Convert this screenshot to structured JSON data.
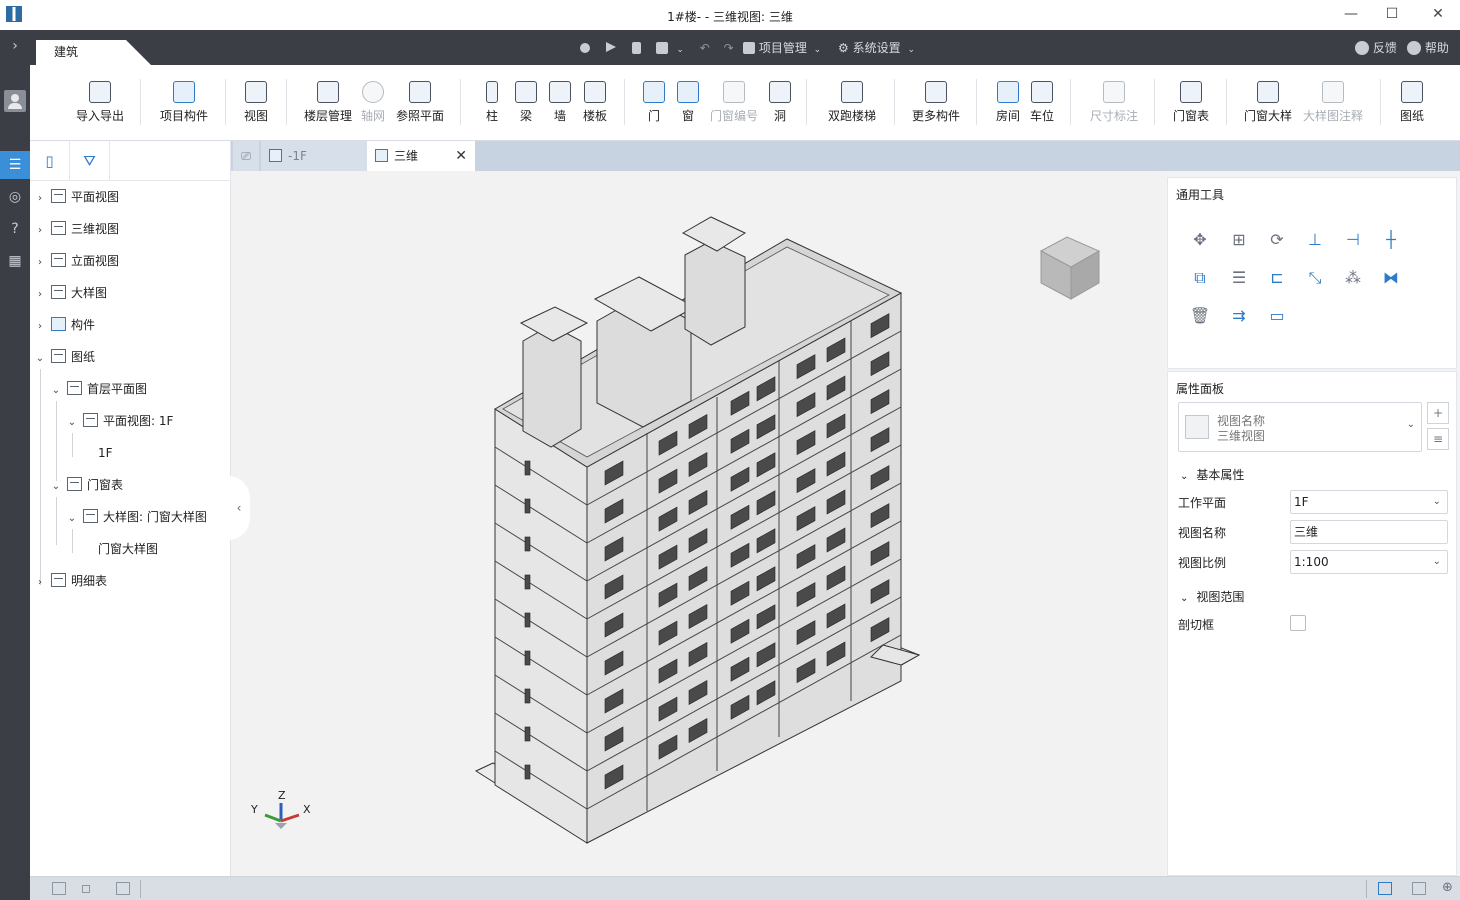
{
  "window": {
    "title": "1#楼- - 三维视图: 三维",
    "controls": [
      "—",
      "☐",
      "✕"
    ]
  },
  "rail": {
    "items": [
      "expand-icon",
      "user-icon",
      "list-icon",
      "compass-icon",
      "help-icon",
      "grid-icon"
    ]
  },
  "header": {
    "tab_label": "建筑",
    "project_menu": "项目管理",
    "settings_menu": "系统设置",
    "feedback": "反馈",
    "help": "帮助"
  },
  "ribbon": {
    "buttons": [
      {
        "label": "导入导出",
        "icon": "cad-icon",
        "enabled": true
      },
      {
        "label": "项目构件",
        "icon": "component-icon",
        "enabled": true
      },
      {
        "label": "视图",
        "icon": "view-icon",
        "enabled": true
      },
      {
        "label": "楼层管理",
        "icon": "floor-icon",
        "enabled": true
      },
      {
        "label": "轴网",
        "icon": "grid-axis-icon",
        "enabled": false
      },
      {
        "label": "参照平面",
        "icon": "ref-plane-icon",
        "enabled": true
      },
      {
        "label": "柱",
        "icon": "column-icon",
        "enabled": true
      },
      {
        "label": "梁",
        "icon": "beam-icon",
        "enabled": true
      },
      {
        "label": "墙",
        "icon": "wall-icon",
        "enabled": true
      },
      {
        "label": "楼板",
        "icon": "slab-icon",
        "enabled": true
      },
      {
        "label": "门",
        "icon": "door-icon",
        "enabled": true
      },
      {
        "label": "窗",
        "icon": "window-icon",
        "enabled": true
      },
      {
        "label": "门窗编号",
        "icon": "tag-icon",
        "enabled": false
      },
      {
        "label": "洞",
        "icon": "opening-icon",
        "enabled": true
      },
      {
        "label": "双跑楼梯",
        "icon": "stair-icon",
        "enabled": true
      },
      {
        "label": "更多构件",
        "icon": "more-component-icon",
        "enabled": true
      },
      {
        "label": "房间",
        "icon": "room-icon",
        "enabled": true
      },
      {
        "label": "车位",
        "icon": "parking-icon",
        "enabled": true
      },
      {
        "label": "尺寸标注",
        "icon": "dimension-icon",
        "enabled": false
      },
      {
        "label": "门窗表",
        "icon": "schedule-icon",
        "enabled": true
      },
      {
        "label": "门窗大样",
        "icon": "detail-icon",
        "enabled": true
      },
      {
        "label": "大样图注释",
        "icon": "annotation-icon",
        "enabled": false
      },
      {
        "label": "图纸",
        "icon": "sheet-icon",
        "enabled": true
      }
    ]
  },
  "tree": {
    "items": [
      {
        "label": "平面视图",
        "level": 0,
        "expanded": false
      },
      {
        "label": "三维视图",
        "level": 0,
        "expanded": false
      },
      {
        "label": "立面视图",
        "level": 0,
        "expanded": false
      },
      {
        "label": "大样图",
        "level": 0,
        "expanded": false
      },
      {
        "label": "构件",
        "level": 0,
        "expanded": false
      },
      {
        "label": "图纸",
        "level": 0,
        "expanded": true
      },
      {
        "label": "首层平面图",
        "level": 1,
        "expanded": true
      },
      {
        "label": "平面视图: 1F",
        "level": 2,
        "expanded": true
      },
      {
        "label": "1F",
        "level": 3,
        "expanded": null
      },
      {
        "label": "门窗表",
        "level": 1,
        "expanded": true
      },
      {
        "label": "大样图: 门窗大样图",
        "level": 2,
        "expanded": true
      },
      {
        "label": "门窗大样图",
        "level": 3,
        "expanded": null
      },
      {
        "label": "明细表",
        "level": 0,
        "expanded": false
      }
    ]
  },
  "doc_tabs": [
    {
      "label": "-1F",
      "active": false
    },
    {
      "label": "三维",
      "active": true
    }
  ],
  "right_panel": {
    "tools_title": "通用工具",
    "properties_title": "属性面板",
    "view_card": {
      "line1": "视图名称",
      "line2": "三维视图"
    },
    "basic_section": "基本属性",
    "range_section": "视图范围",
    "properties": [
      {
        "label": "工作平面",
        "value": "1F",
        "type": "select"
      },
      {
        "label": "视图名称",
        "value": "三维",
        "type": "text"
      },
      {
        "label": "视图比例",
        "value": "1:100",
        "type": "select"
      }
    ],
    "section_box_label": "剖切框",
    "section_box_checked": false
  },
  "axes": {
    "x": "X",
    "y": "Y",
    "z": "Z"
  },
  "colors": {
    "dark": "#3b3e45",
    "accent": "#2e7bc7",
    "tab_bar": "#c8d3e2",
    "canvas": "#f2f2f2"
  }
}
